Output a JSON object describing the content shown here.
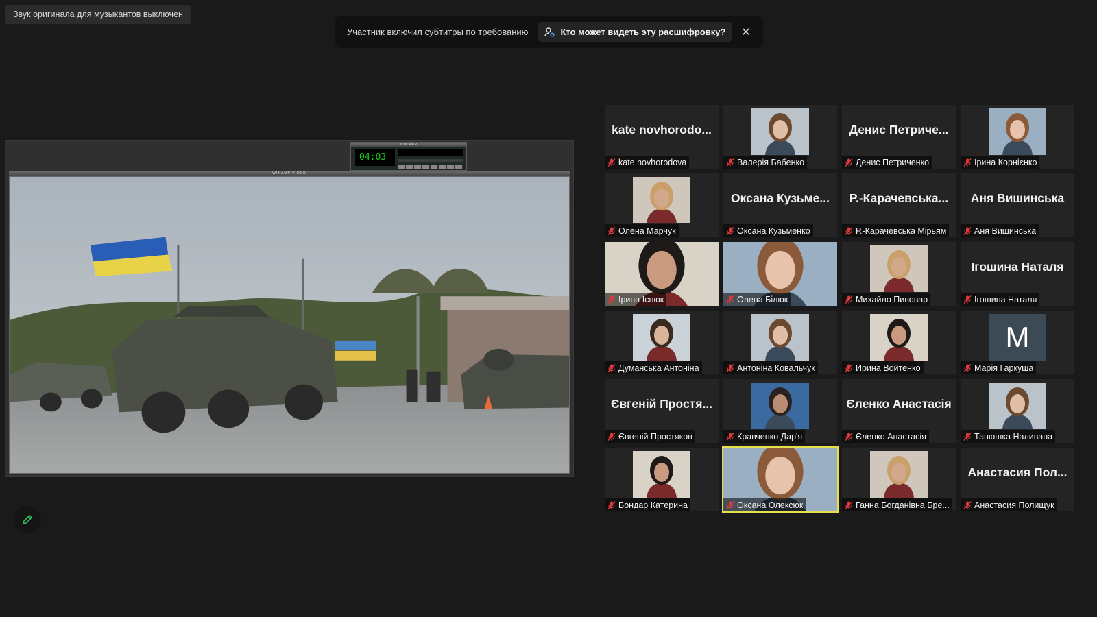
{
  "notice": {
    "text": "Звук оригинала для музыкантов выключен"
  },
  "captions_banner": {
    "message": "Участник включил субтитры по требованию",
    "who_can_see_label": "Кто может видеть эту расшифровку?",
    "close_symbol": "✕"
  },
  "shared_screen": {
    "winamp_title": "WINAMP",
    "winamp_time": "04:03",
    "video_window_title": "WINAMP VIDEO"
  },
  "participants": [
    {
      "big_name": "kate novhorodo...",
      "name": "kate novhorodova",
      "video": false
    },
    {
      "big_name": "",
      "name": "Валерія Бабенко",
      "video": true
    },
    {
      "big_name": "Денис Петриче...",
      "name": "Денис Петриченко",
      "video": false
    },
    {
      "big_name": "",
      "name": "Ірина Корнієнко",
      "video": true
    },
    {
      "big_name": "",
      "name": "Олена Марчук",
      "video": true
    },
    {
      "big_name": "Оксана Кузьме...",
      "name": "Оксана Кузьменко",
      "video": false
    },
    {
      "big_name": "Р.-Карачевська...",
      "name": "Р.-Карачевська Мірьям",
      "video": false
    },
    {
      "big_name": "Аня Вишинська",
      "name": "Аня Вишинська",
      "video": false
    },
    {
      "big_name": "",
      "name": "Ірина Існюк",
      "video": true,
      "full": true
    },
    {
      "big_name": "",
      "name": "Олена Білюк",
      "video": true,
      "full": true
    },
    {
      "big_name": "",
      "name": "Михайло Пивовар",
      "video": true
    },
    {
      "big_name": "Ігошина Наталя",
      "name": "Ігошина Наталя",
      "video": false
    },
    {
      "big_name": "",
      "name": "Думанська Антоніна",
      "video": true
    },
    {
      "big_name": "",
      "name": "Антоніна Ковальчук",
      "video": true
    },
    {
      "big_name": "",
      "name": "Ирина Войтенко",
      "video": true
    },
    {
      "big_name": "",
      "name": "Марія Гаркуша",
      "video": false,
      "avatar_letter": "M"
    },
    {
      "big_name": "Євгеній Простя...",
      "name": "Євгеній Простяков",
      "video": false
    },
    {
      "big_name": "",
      "name": "Кравченко Дар'я",
      "video": true
    },
    {
      "big_name": "Єленко Анастасія",
      "name": "Єленко Анастасія",
      "video": false
    },
    {
      "big_name": "",
      "name": "Танюшка Наливана",
      "video": true
    },
    {
      "big_name": "",
      "name": "Бондар Катерина",
      "video": true
    },
    {
      "big_name": "",
      "name": "Оксана Олексюк",
      "video": true,
      "full": true,
      "active_speaker": true
    },
    {
      "big_name": "",
      "name": "Ганна Богданівна Бре...",
      "video": true
    },
    {
      "big_name": "Анастасия Пол...",
      "name": "Анастасия Полищук",
      "video": false
    }
  ],
  "colors": {
    "background": "#1a1a1a",
    "tile": "#242424",
    "muted_mic": "#e03a3a",
    "active_speaker_border": "#e8e04a",
    "pencil_green": "#2fbf5b"
  },
  "icons": {
    "mic": "muted-mic-icon",
    "pencil": "pencil-icon",
    "who": "person-settings-icon"
  }
}
